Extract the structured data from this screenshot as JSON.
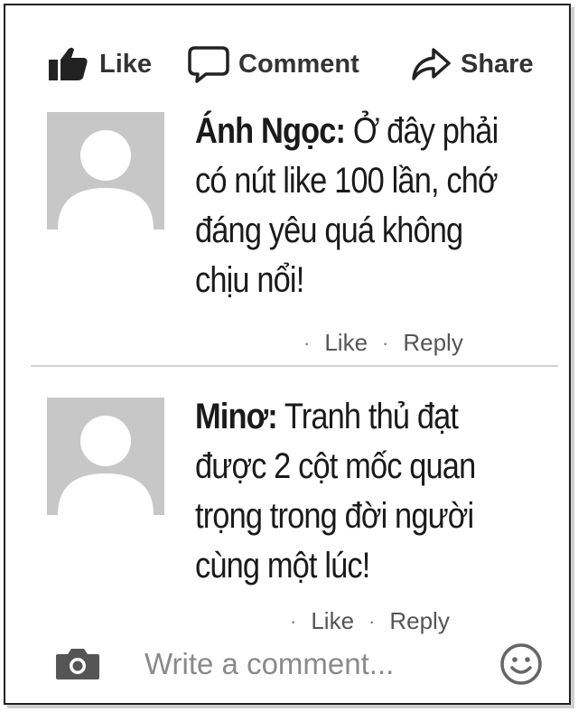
{
  "actions": {
    "like": "Like",
    "comment": "Comment",
    "share": "Share"
  },
  "comments": [
    {
      "author": "Ánh Ngọc:",
      "text": "Ở đây phải có nút like 100 lần, chớ đáng yêu quá không chịu nổi!",
      "like": "Like",
      "reply": "Reply"
    },
    {
      "author": "Minơ:",
      "text": "Tranh thủ đạt được 2 cột mốc quan trọng trong đời người cùng một lúc!",
      "like": "Like",
      "reply": "Reply"
    }
  ],
  "composer": {
    "placeholder": "Write a comment..."
  },
  "icons": {
    "like": "thumbs-up-icon",
    "comment": "speech-bubble-icon",
    "share": "share-arrow-icon",
    "camera": "camera-icon",
    "emoji": "smiley-icon"
  }
}
